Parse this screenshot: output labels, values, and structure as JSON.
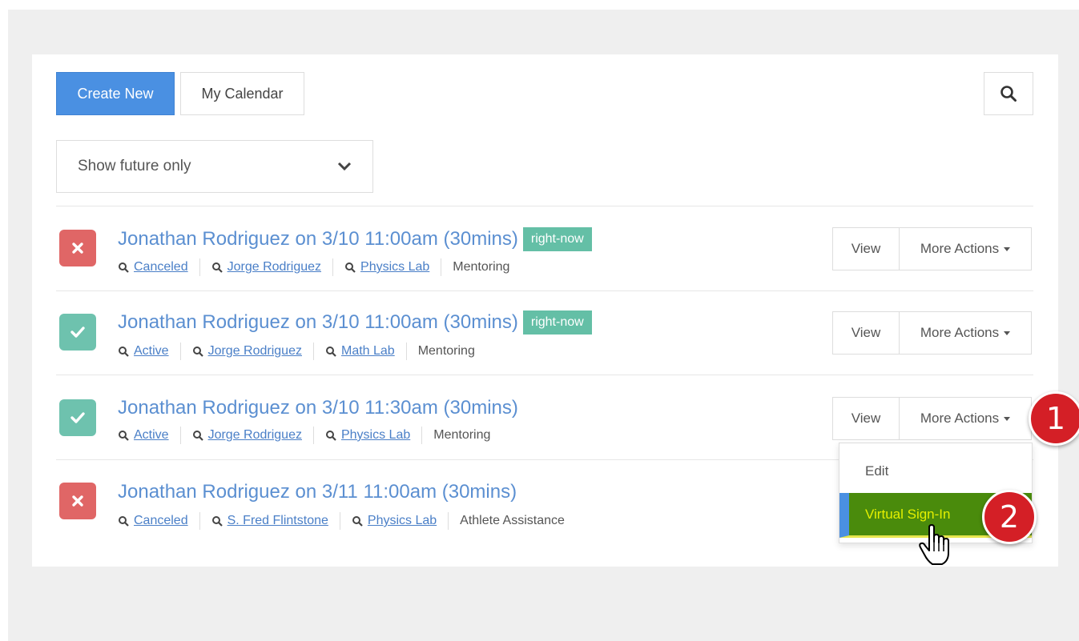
{
  "toolbar": {
    "create_label": "Create New",
    "calendar_label": "My Calendar"
  },
  "filter": {
    "selected": "Show future only"
  },
  "appointments": [
    {
      "status_icon": "x-icon",
      "title": "Jonathan Rodriguez on 3/10 11:00am (30mins)",
      "badge": "right-now",
      "status": "Canceled",
      "person": "Jorge Rodriguez",
      "location": "Physics Lab",
      "type": "Mentoring"
    },
    {
      "status_icon": "check-icon",
      "title": "Jonathan Rodriguez on 3/10 11:00am (30mins)",
      "badge": "right-now",
      "status": "Active",
      "person": "Jorge Rodriguez",
      "location": "Math Lab",
      "type": "Mentoring"
    },
    {
      "status_icon": "check-icon",
      "title": "Jonathan Rodriguez on 3/10 11:30am (30mins)",
      "badge": "",
      "status": "Active",
      "person": "Jorge Rodriguez",
      "location": "Physics Lab",
      "type": "Mentoring"
    },
    {
      "status_icon": "x-icon",
      "title": "Jonathan Rodriguez on 3/11 11:00am (30mins)",
      "badge": "",
      "status": "Canceled",
      "person": "S. Fred Flintstone",
      "location": "Physics Lab",
      "type": "Athlete Assistance"
    }
  ],
  "row_actions": {
    "view_label": "View",
    "more_label": "More Actions"
  },
  "dropdown_menu": {
    "edit_label": "Edit",
    "virtual_label": "Virtual Sign-In"
  },
  "callouts": [
    "1",
    "2"
  ],
  "colors": {
    "primary": "#4a90e2",
    "canceled": "#e06666",
    "active": "#6ec2ae",
    "badge": "#64bfa6",
    "link": "#5b8fd1",
    "callout": "#d41f26",
    "highlight": "#4a8b0c"
  }
}
